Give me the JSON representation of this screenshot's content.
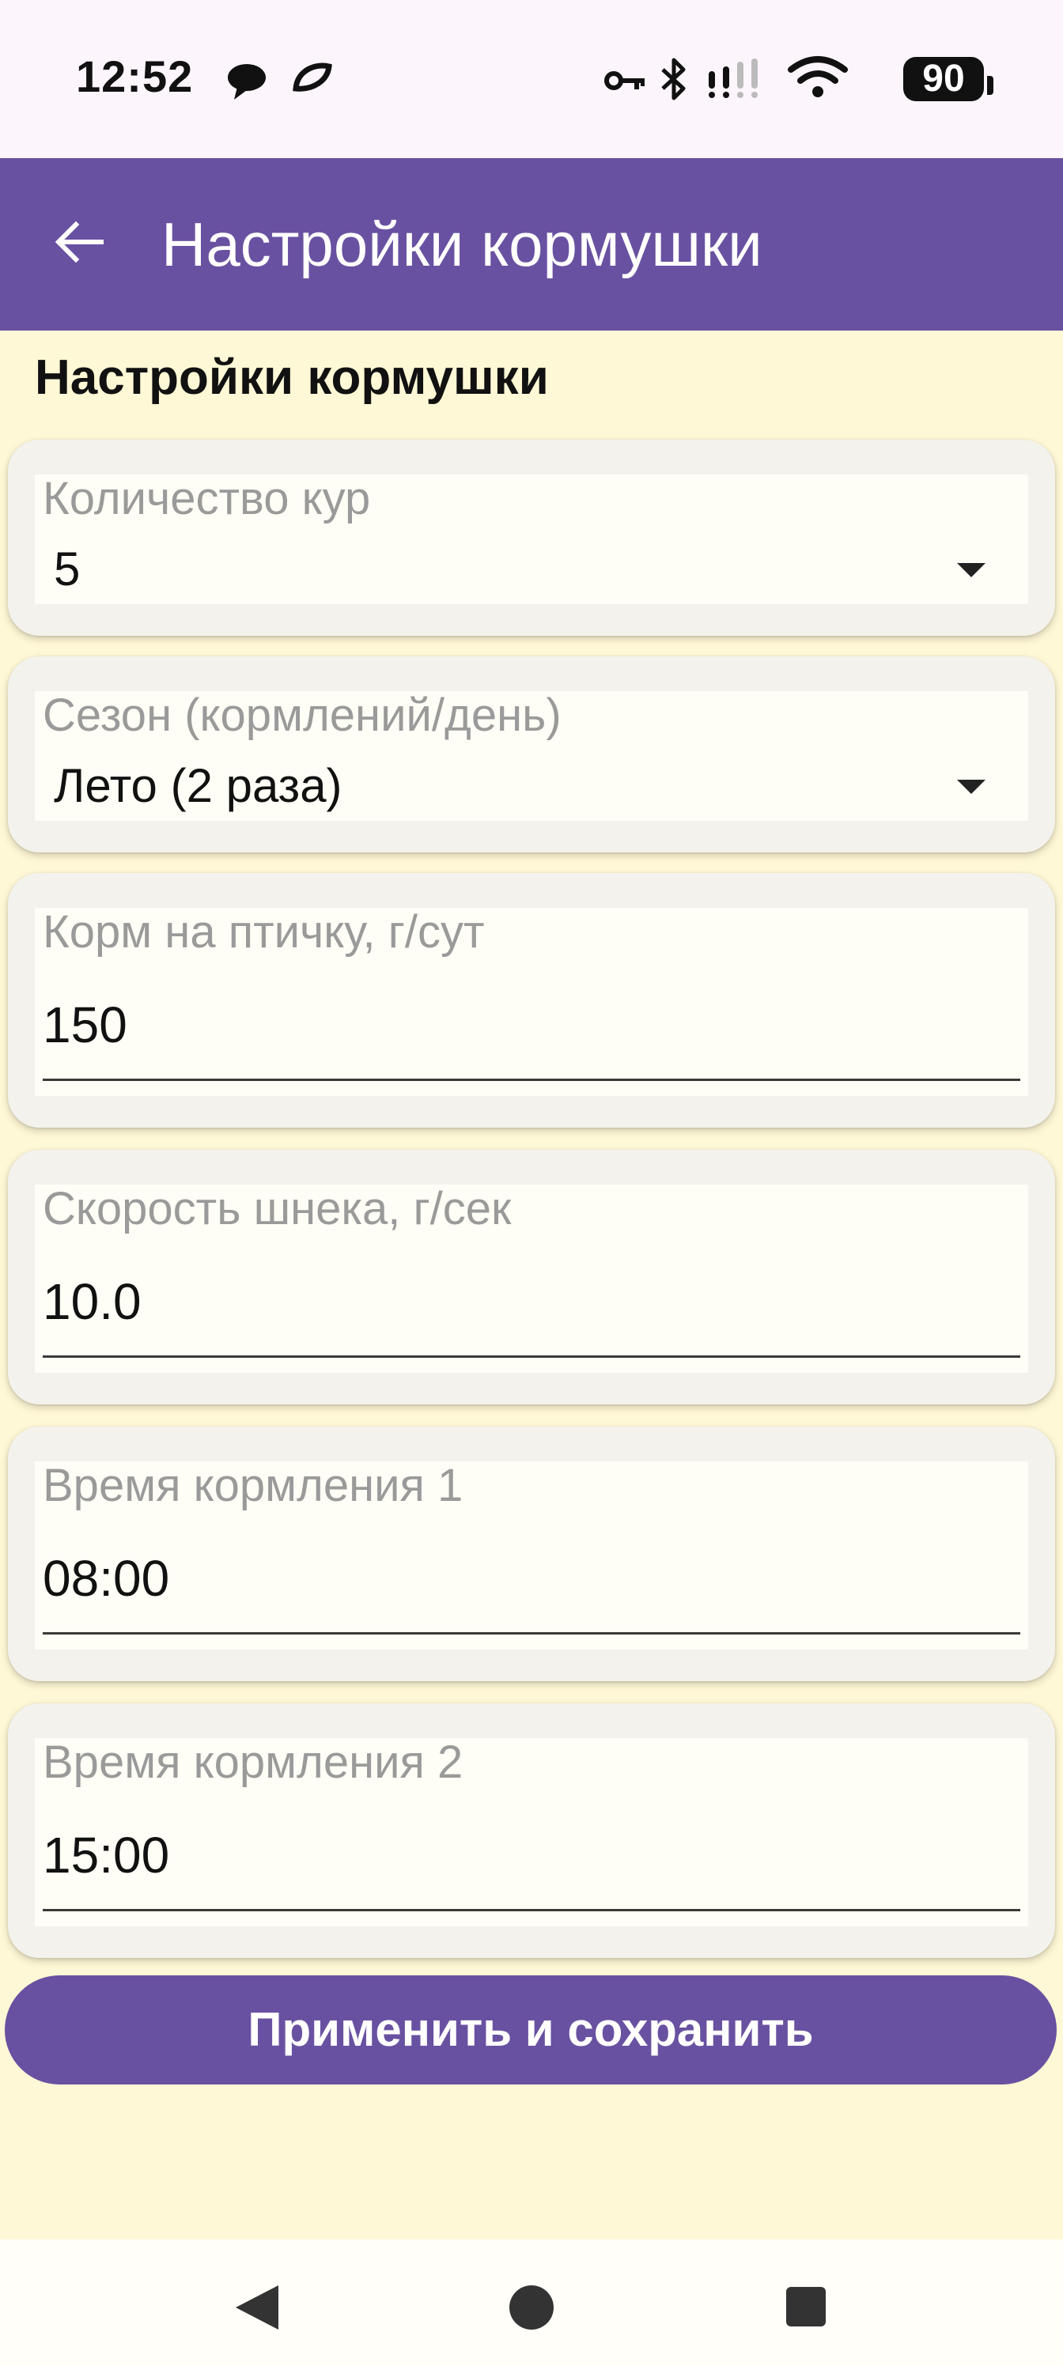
{
  "status_bar": {
    "time": "12:52",
    "left_icons": [
      "chat-bubble-icon",
      "leaf-icon"
    ],
    "right_icons": [
      "vpn-key-icon",
      "bluetooth-icon",
      "signal-icon",
      "wifi-icon"
    ],
    "battery": "90"
  },
  "app_bar": {
    "title": "Настройки кормушки",
    "back_icon": "arrow-left-icon",
    "color": "#6951A1"
  },
  "main": {
    "section_title": "Настройки кормушки",
    "fields": {
      "hens": {
        "label": "Количество кур",
        "value": "5"
      },
      "season": {
        "label": "Сезон (кормлений/день)",
        "value": "Лето (2 раза)"
      },
      "feed_per_bird": {
        "label": "Корм на птичку, г/сут",
        "value": "150"
      },
      "auger_speed": {
        "label": "Скорость шнека, г/сек",
        "value": "10.0"
      },
      "feed_time_1": {
        "label": "Время кормления 1",
        "value": "08:00"
      },
      "feed_time_2": {
        "label": "Время кормления 2",
        "value": "15:00"
      }
    },
    "apply_button": "Применить и сохранить",
    "background": "#FFF8D6"
  },
  "nav_bar": {
    "icons": [
      "nav-back-icon",
      "nav-home-icon",
      "nav-recents-icon"
    ]
  }
}
